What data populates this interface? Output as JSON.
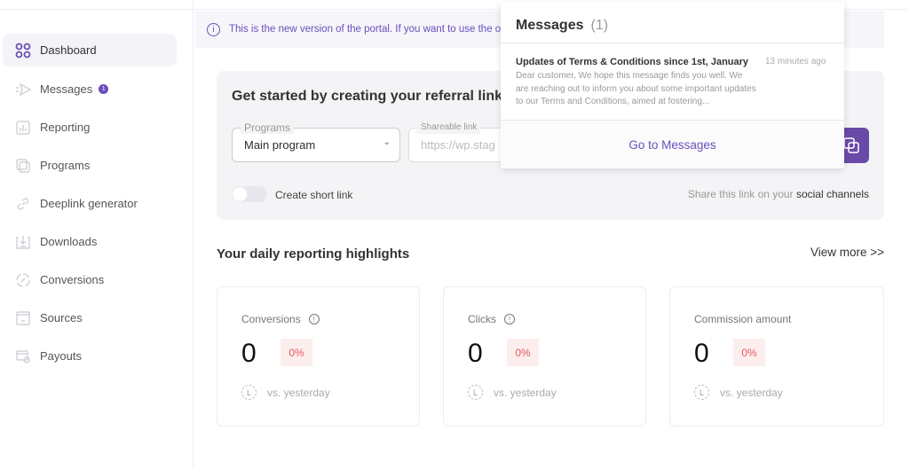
{
  "sidebar": {
    "items": [
      {
        "label": "Dashboard",
        "icon": "dashboard-grid-icon",
        "active": true
      },
      {
        "label": "Messages",
        "icon": "send-icon",
        "badge": "1"
      },
      {
        "label": "Reporting",
        "icon": "report-icon"
      },
      {
        "label": "Programs",
        "icon": "programs-icon"
      },
      {
        "label": "Deeplink generator",
        "icon": "link-icon"
      },
      {
        "label": "Downloads",
        "icon": "download-icon"
      },
      {
        "label": "Conversions",
        "icon": "percent-icon"
      },
      {
        "label": "Sources",
        "icon": "sources-icon"
      },
      {
        "label": "Payouts",
        "icon": "payouts-icon"
      }
    ]
  },
  "banner": {
    "text": "This is the new version of the portal. If you want to use the old"
  },
  "referral": {
    "title": "Get started by creating your referral link",
    "programs_label": "Programs",
    "programs_value": "Main program",
    "link_label": "Shareable link",
    "link_value": "https://wp.stag",
    "short_link_label": "Create short link",
    "short_link_on": false,
    "share_text": "Share this link on your ",
    "share_bold": "social channels"
  },
  "highlights": {
    "title": "Your daily reporting highlights",
    "view_more": "View more >>",
    "cards": [
      {
        "label": "Conversions",
        "value": "0",
        "change": "0%",
        "compare": "vs. yesterday",
        "info": true
      },
      {
        "label": "Clicks",
        "value": "0",
        "change": "0%",
        "compare": "vs. yesterday",
        "info": true
      },
      {
        "label": "Commission amount",
        "value": "0",
        "change": "0%",
        "compare": "vs. yesterday",
        "info": false
      }
    ]
  },
  "popup": {
    "title": "Messages",
    "count": "(1)",
    "message": {
      "title": "Updates of Terms & Conditions since 1st, January",
      "time": "13 minutes ago",
      "body": "Dear customer, We hope this message finds you well. We are reaching out to inform you about some important updates to our Terms and Conditions, aimed at fostering..."
    },
    "footer": "Go to Messages"
  },
  "colors": {
    "accent": "#6b4fbb",
    "negative": "#e05c5c"
  }
}
